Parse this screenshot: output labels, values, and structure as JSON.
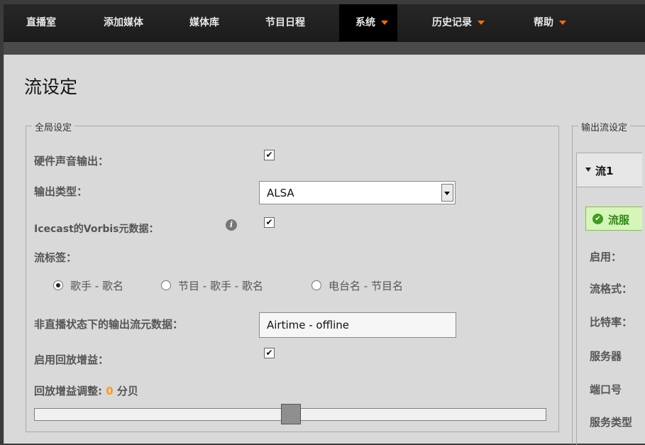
{
  "nav": {
    "items": [
      {
        "label": "直播室"
      },
      {
        "label": "添加媒体"
      },
      {
        "label": "媒体库"
      },
      {
        "label": "节目日程"
      },
      {
        "label": "系统"
      },
      {
        "label": "历史记录"
      },
      {
        "label": "帮助"
      }
    ],
    "active": "系统",
    "accent_color": "#ff6c0a"
  },
  "page": {
    "title": "流设定"
  },
  "global": {
    "legend": "全局设定",
    "hardware_output_label": "硬件声音输出：",
    "hardware_output_checked": true,
    "output_type_label": "输出类型：",
    "output_type_value": "ALSA",
    "icecast_vorbis_label": "Icecast的Vorbis元数据：",
    "icecast_vorbis_checked": true,
    "stream_label_label": "流标签：",
    "stream_label_options": [
      {
        "label": "歌手 - 歌名",
        "selected": true
      },
      {
        "label": "节目 - 歌手 - 歌名",
        "selected": false
      },
      {
        "label": "电台名 - 节目名",
        "selected": false
      }
    ],
    "offline_metadata_label": "非直播状态下的输出流元数据：",
    "offline_metadata_value": "Airtime - offline",
    "replay_gain_label": "启用回放增益：",
    "replay_gain_checked": true,
    "replay_gain_adjust_label": "回放增益调整:",
    "replay_gain_value": "0",
    "replay_gain_unit": "分贝",
    "replay_gain_slider_fraction": 0.5
  },
  "output": {
    "legend": "输出流设定",
    "stream_title": "流1",
    "status_text": "流服",
    "labels": [
      "启用：",
      "流格式：",
      "比特率：",
      "服务器",
      "端口号",
      "服务类型"
    ]
  }
}
